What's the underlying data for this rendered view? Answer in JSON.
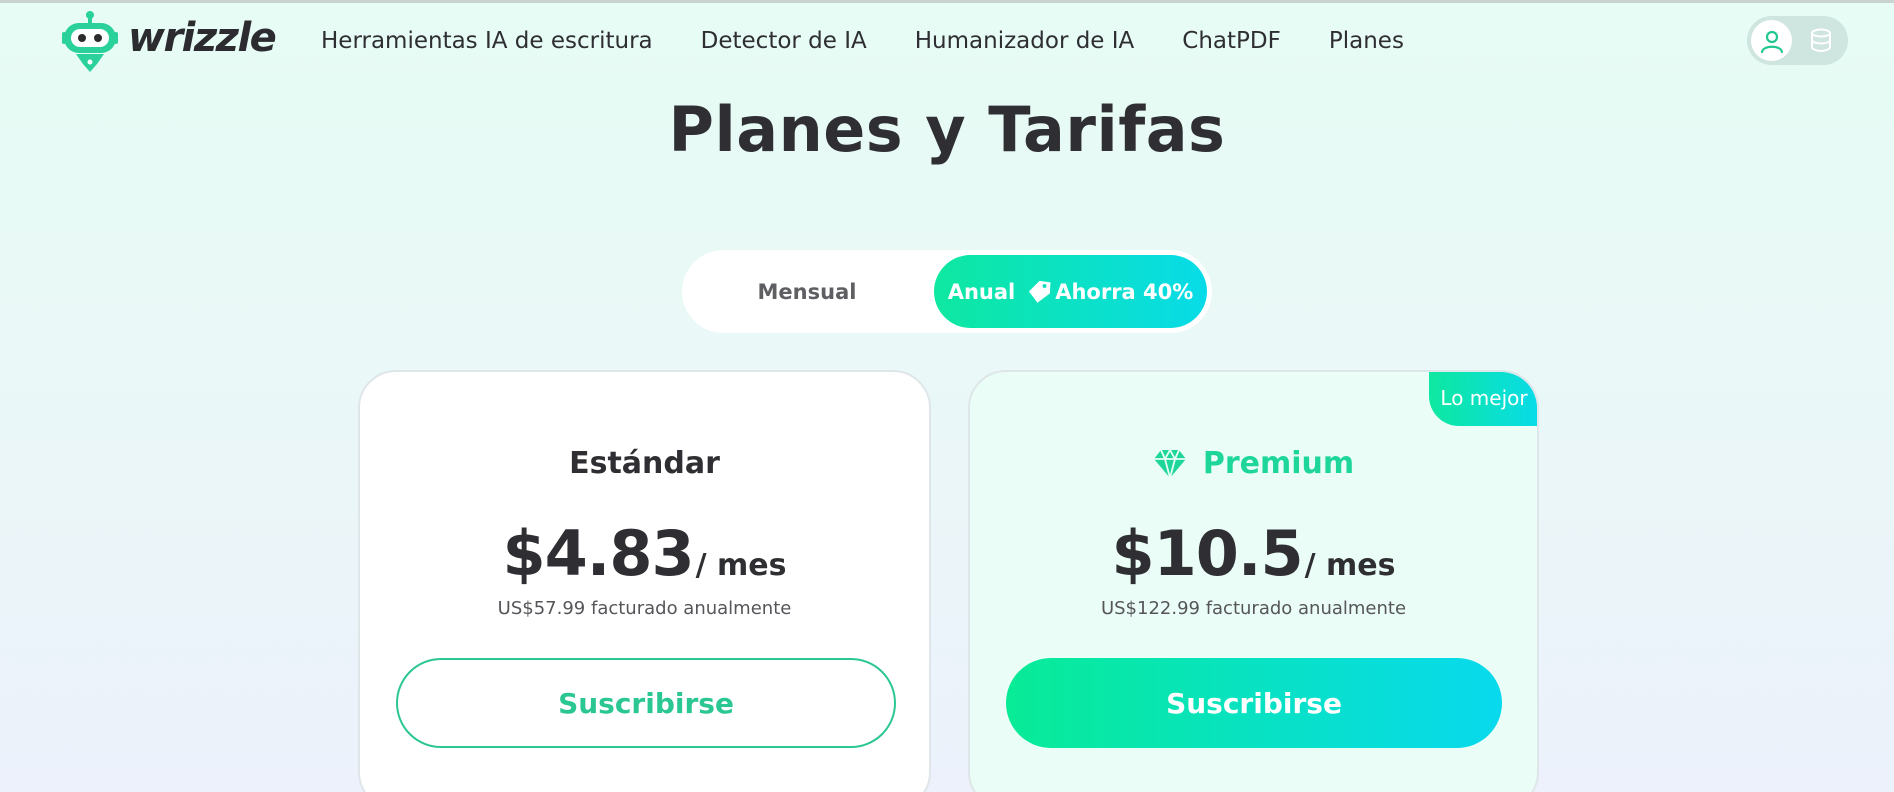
{
  "header": {
    "brand": "wrizzle",
    "nav": [
      {
        "label": "Herramientas IA de escritura"
      },
      {
        "label": "Detector de IA"
      },
      {
        "label": "Humanizador de IA"
      },
      {
        "label": "ChatPDF"
      },
      {
        "label": "Planes"
      }
    ],
    "icons": [
      "robot-logo-icon",
      "user-icon",
      "coins-icon"
    ]
  },
  "page": {
    "title": "Planes y Tarifas"
  },
  "billing_toggle": {
    "monthly_label": "Mensual",
    "annual_label": "Anual",
    "discount_label": "Ahorra 40%",
    "selected": "Anual"
  },
  "plans": [
    {
      "name": "Estándar",
      "price": "$4.83",
      "per": "/ mes",
      "billed": "US$57.99 facturado anualmente",
      "cta": "Suscribirse"
    },
    {
      "name": "Premium",
      "badge": "Lo mejor",
      "price": "$10.5",
      "per": "/ mes",
      "billed": "US$122.99 facturado anualmente",
      "cta": "Suscribirse"
    }
  ],
  "colors": {
    "accent_green": "#1ed69a",
    "gradient_start": "#0ee8a0",
    "gradient_end": "#08dbe8",
    "text_dark": "#2f2f33"
  }
}
